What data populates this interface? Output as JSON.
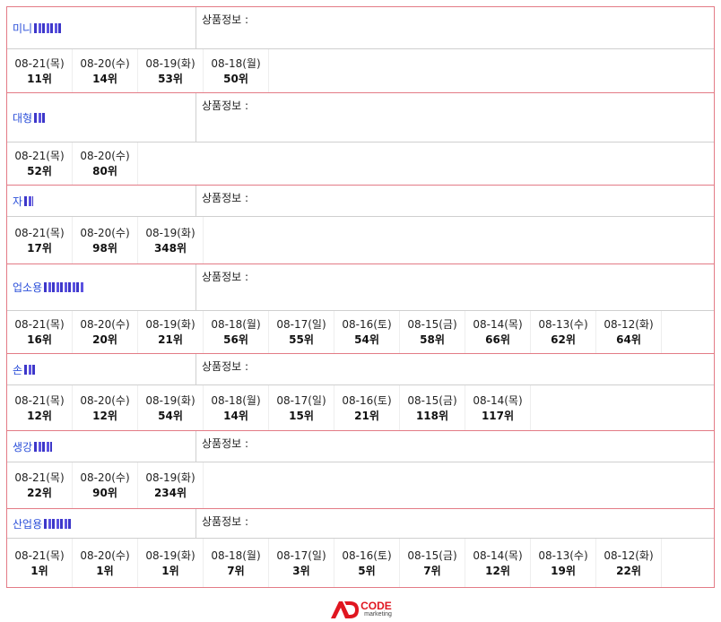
{
  "info_label": "상품정보 :",
  "blocks": [
    {
      "keyword": "미니",
      "top_height": 47,
      "rank_height": 48,
      "redact_w": 30,
      "ranks": [
        {
          "date": "08-21(목)",
          "rank": "11위"
        },
        {
          "date": "08-20(수)",
          "rank": "14위"
        },
        {
          "date": "08-19(화)",
          "rank": "53위"
        },
        {
          "date": "08-18(월)",
          "rank": "50위"
        }
      ]
    },
    {
      "keyword": "대형",
      "top_height": 55,
      "rank_height": 47,
      "redact_w": 14,
      "ranks": [
        {
          "date": "08-21(목)",
          "rank": "52위"
        },
        {
          "date": "08-20(수)",
          "rank": "80위"
        }
      ]
    },
    {
      "keyword": "자",
      "top_height": 35,
      "rank_height": 52,
      "redact_w": 10,
      "ranks": [
        {
          "date": "08-21(목)",
          "rank": "17위"
        },
        {
          "date": "08-20(수)",
          "rank": "98위"
        },
        {
          "date": "08-19(화)",
          "rank": "348위"
        }
      ]
    },
    {
      "keyword": "업소용",
      "top_height": 52,
      "rank_height": 47,
      "redact_w": 44,
      "ranks": [
        {
          "date": "08-21(목)",
          "rank": "16위"
        },
        {
          "date": "08-20(수)",
          "rank": "20위"
        },
        {
          "date": "08-19(화)",
          "rank": "21위"
        },
        {
          "date": "08-18(월)",
          "rank": "56위"
        },
        {
          "date": "08-17(일)",
          "rank": "55위"
        },
        {
          "date": "08-16(토)",
          "rank": "54위"
        },
        {
          "date": "08-15(금)",
          "rank": "58위"
        },
        {
          "date": "08-14(목)",
          "rank": "66위"
        },
        {
          "date": "08-13(수)",
          "rank": "62위"
        },
        {
          "date": "08-12(화)",
          "rank": "64위"
        }
      ]
    },
    {
      "keyword": "손",
      "top_height": 35,
      "rank_height": 50,
      "redact_w": 12,
      "ranks": [
        {
          "date": "08-21(목)",
          "rank": "12위"
        },
        {
          "date": "08-20(수)",
          "rank": "12위"
        },
        {
          "date": "08-19(화)",
          "rank": "54위"
        },
        {
          "date": "08-18(월)",
          "rank": "14위"
        },
        {
          "date": "08-17(일)",
          "rank": "15위"
        },
        {
          "date": "08-16(토)",
          "rank": "21위"
        },
        {
          "date": "08-15(금)",
          "rank": "118위"
        },
        {
          "date": "08-14(목)",
          "rank": "117위"
        }
      ]
    },
    {
      "keyword": "생강",
      "top_height": 35,
      "rank_height": 51,
      "redact_w": 20,
      "ranks": [
        {
          "date": "08-21(목)",
          "rank": "22위"
        },
        {
          "date": "08-20(수)",
          "rank": "90위"
        },
        {
          "date": "08-19(화)",
          "rank": "234위"
        }
      ]
    },
    {
      "keyword": "산업용",
      "top_height": 33,
      "rank_height": 54,
      "redact_w": 30,
      "ranks": [
        {
          "date": "08-21(목)",
          "rank": "1위"
        },
        {
          "date": "08-20(수)",
          "rank": "1위"
        },
        {
          "date": "08-19(화)",
          "rank": "1위"
        },
        {
          "date": "08-18(월)",
          "rank": "7위"
        },
        {
          "date": "08-17(일)",
          "rank": "3위"
        },
        {
          "date": "08-16(토)",
          "rank": "5위"
        },
        {
          "date": "08-15(금)",
          "rank": "7위"
        },
        {
          "date": "08-14(목)",
          "rank": "12위"
        },
        {
          "date": "08-13(수)",
          "rank": "19위"
        },
        {
          "date": "08-12(화)",
          "rank": "22위"
        }
      ]
    }
  ],
  "footer": {
    "logo_text": "CODE",
    "logo_sub": "marketing",
    "brand_color": "#e01620"
  }
}
